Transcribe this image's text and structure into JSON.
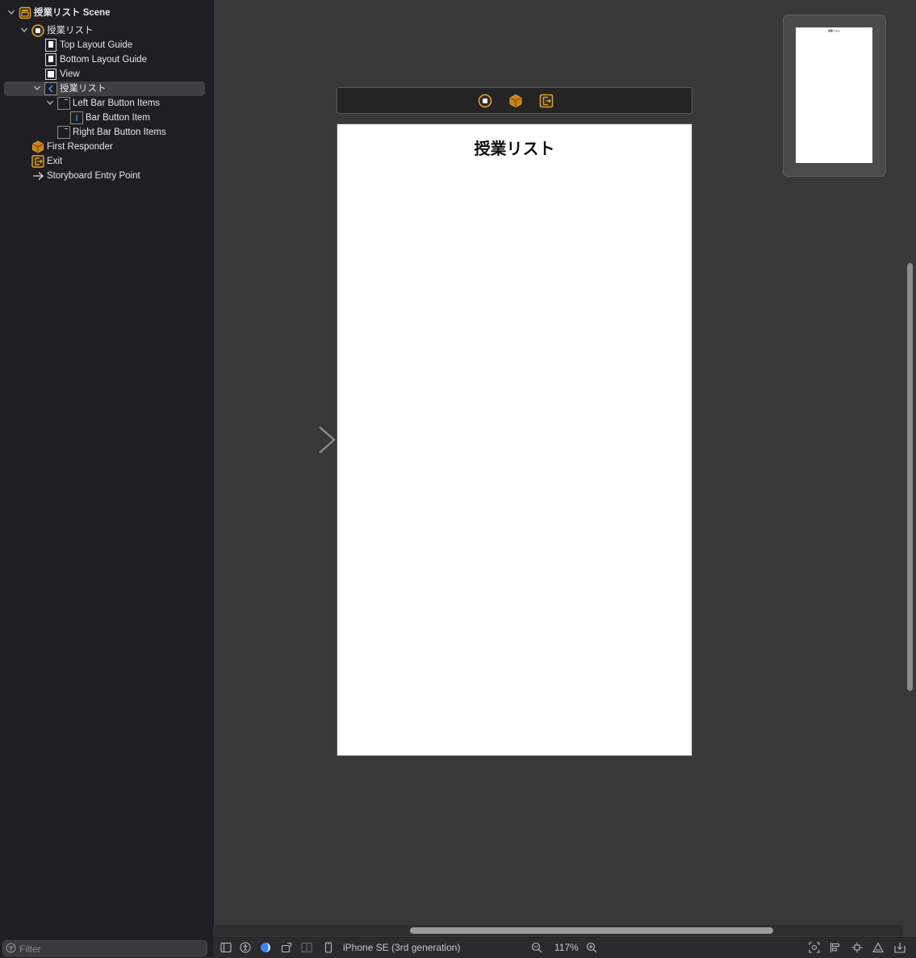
{
  "outline": {
    "items": [
      {
        "label": "授業リスト Scene",
        "icon": "scene-icon"
      },
      {
        "label": "授業リスト",
        "icon": "view-controller-icon"
      },
      {
        "label": "Top Layout Guide",
        "icon": "layout-guide-icon"
      },
      {
        "label": "Bottom Layout Guide",
        "icon": "layout-guide-icon"
      },
      {
        "label": "View",
        "icon": "view-icon"
      },
      {
        "label": "授業リスト",
        "icon": "navigation-item-icon"
      },
      {
        "label": "Left Bar Button Items",
        "icon": "bar-button-items-icon"
      },
      {
        "label": "Bar Button Item",
        "icon": "bar-button-item-icon"
      },
      {
        "label": "Right Bar Button Items",
        "icon": "bar-button-items-icon"
      },
      {
        "label": "First Responder",
        "icon": "first-responder-icon"
      },
      {
        "label": "Exit",
        "icon": "exit-icon"
      },
      {
        "label": "Storyboard Entry Point",
        "icon": "arrow-right-icon"
      }
    ],
    "filter_placeholder": "Filter"
  },
  "canvas": {
    "nav_title": "授業リスト",
    "minimap_title": "授業リスト"
  },
  "bottom_bar": {
    "device": "iPhone SE (3rd generation)",
    "zoom": "117%"
  },
  "colors": {
    "accent_orange": "#e5a21f",
    "selection": "#3f3f44",
    "appearance_blue": "#3b82f6"
  }
}
